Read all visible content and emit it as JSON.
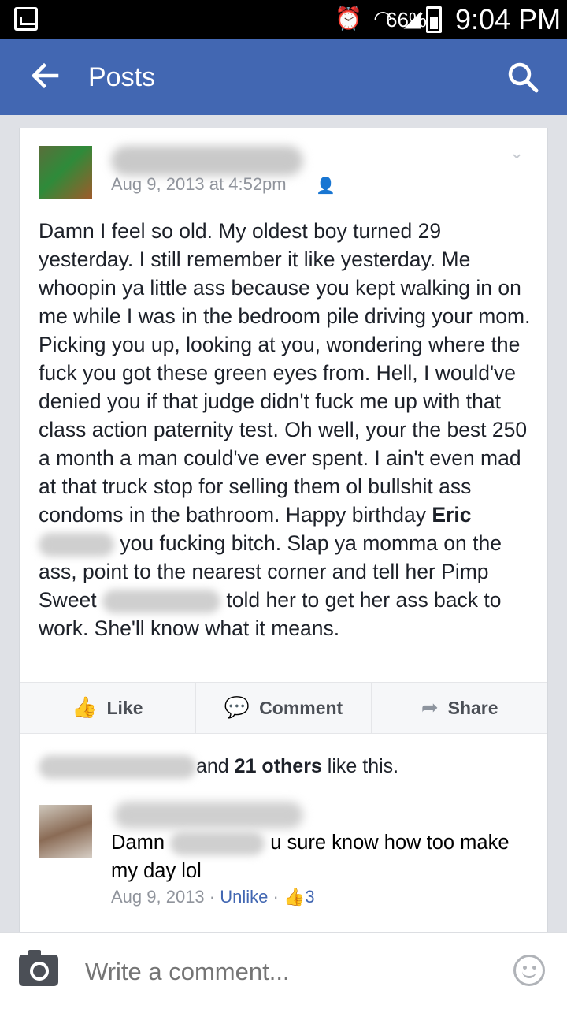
{
  "status_bar": {
    "battery": "66%",
    "time": "9:04 PM",
    "icons": [
      "gallery-icon",
      "alarm-icon",
      "wifi-icon",
      "signal-icon",
      "battery-icon"
    ]
  },
  "app_bar": {
    "title": "Posts",
    "back_icon": "arrow-left-icon",
    "search_icon": "search-icon",
    "color": "#4267b2"
  },
  "post": {
    "timestamp": "Aug 9, 2013 at 4:52pm",
    "privacy_icon": "friends-icon",
    "text_1": "Damn I feel so old. My oldest boy turned 29 yesterday. I still remember it like yesterday. Me whoopin ya little ass because you kept walking in on me while I was in the bedroom pile driving your mom. Picking you up, looking at you, wondering where the fuck you got these green eyes from. Hell, I would've denied you if that judge didn't fuck me up with that class action paternity test. Oh well, your the best 250 a month a man could've ever spent. I ain't even mad at that truck stop for selling them ol bullshit ass condoms in the bathroom. Happy birthday ",
    "tagged_name": "Eric",
    "text_2": " you fucking bitch. Slap ya momma on the ass, point to the nearest corner and tell her Pimp Sweet ",
    "text_3": " told her to get her ass back to work. She'll know what it means."
  },
  "actions": {
    "like": "Like",
    "comment": "Comment",
    "share": "Share"
  },
  "likes": {
    "and": "and ",
    "others": "21 others",
    "suffix": " like this."
  },
  "comment": {
    "text_1": "Damn ",
    "text_2": " u sure know how too make my day lol",
    "date": "Aug 9, 2013",
    "unlike": "Unlike",
    "like_count": "3"
  },
  "composer": {
    "placeholder": "Write a comment..."
  }
}
